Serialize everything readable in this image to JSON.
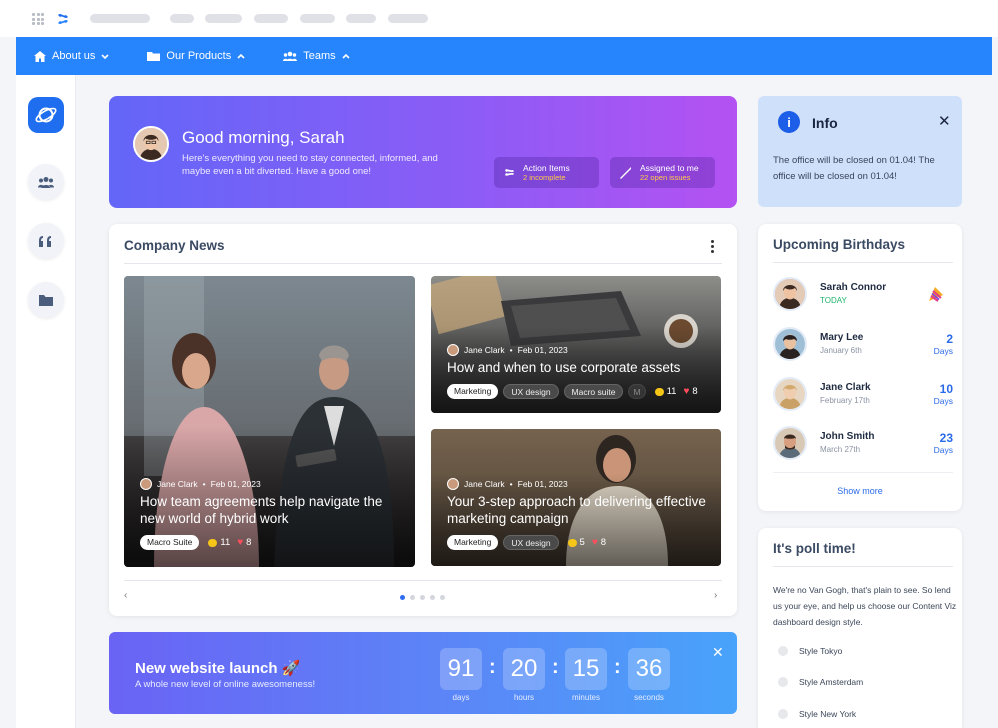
{
  "nav": {
    "items": [
      {
        "label": "About us",
        "icon": "home-icon"
      },
      {
        "label": "Our Products",
        "icon": "folder-icon"
      },
      {
        "label": "Teams",
        "icon": "users-icon"
      }
    ]
  },
  "hero": {
    "greeting": "Good morning, Sarah",
    "text": "Here's everything you need to stay connected, informed, and maybe even a bit diverted. Have a good one!",
    "action_items_label": "Action Items",
    "action_items_sub": "2 incomplete",
    "assigned_label": "Assigned to me",
    "assigned_sub": "22 open issues"
  },
  "info": {
    "title": "Info",
    "icon": "i",
    "close": "✕",
    "text": "The office will be closed on 01.04! The office will be closed on 01.04!"
  },
  "news": {
    "title": "Company News",
    "articles": [
      {
        "author": "Jane Clark",
        "date": "Feb 01, 2023",
        "title": "How team agreements help navigate the new world of hybrid work",
        "tags": [
          "Macro Suite"
        ],
        "comments": "11",
        "likes": "8"
      },
      {
        "author": "Jane Clark",
        "date": "Feb 01, 2023",
        "title": "How and when to use corporate assets",
        "tags": [
          "Marketing",
          "UX design",
          "Macro suite",
          "M"
        ],
        "comments": "11",
        "likes": "8"
      },
      {
        "author": "Jane Clark",
        "date": "Feb 01, 2023",
        "title": "Your 3-step approach to delivering effective marketing campaign",
        "tags": [
          "Marketing",
          "UX design"
        ],
        "comments": "5",
        "likes": "8"
      }
    ],
    "prev": "‹",
    "next": "›",
    "dot_sep": "•"
  },
  "launch": {
    "title": "New website launch 🚀",
    "subtitle": "A whole new level of online awesomeness!",
    "close": "✕",
    "timer": [
      {
        "value": "91",
        "label": "days"
      },
      {
        "value": "20",
        "label": "hours"
      },
      {
        "value": "15",
        "label": "minutes"
      },
      {
        "value": "36",
        "label": "seconds"
      }
    ],
    "sep": ":"
  },
  "birthdays": {
    "title": "Upcoming Birthdays",
    "people": [
      {
        "name": "Sarah Connor",
        "sub": "TODAY",
        "num": "",
        "days": ""
      },
      {
        "name": "Mary Lee",
        "sub": "January 6th",
        "num": "2",
        "days": "Days"
      },
      {
        "name": "Jane Clark",
        "sub": "February 17th",
        "num": "10",
        "days": "Days"
      },
      {
        "name": "John Smith",
        "sub": "March 27th",
        "num": "23",
        "days": "Days"
      }
    ],
    "show_more": "Show more"
  },
  "poll": {
    "title": "It's poll time!",
    "text": "We're no Van Gogh, that's plain to see. So lend us your eye, and help us choose our Content Viz dashboard design style.",
    "options": [
      "Style Tokyo",
      "Style Amsterdam",
      "Style New York"
    ]
  },
  "colors": {
    "nav": "#2684fc",
    "accent": "#2b6be9",
    "hero_start": "#6366f8",
    "hero_end": "#b452f2"
  }
}
